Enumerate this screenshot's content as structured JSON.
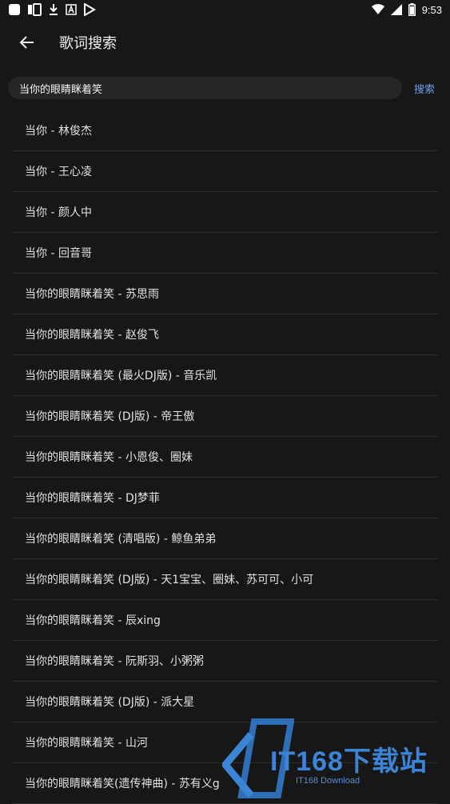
{
  "status_bar": {
    "time": "9:53",
    "left_icons": [
      "app-square-icon",
      "baozi-app-icon",
      "download-icon",
      "a-box-icon",
      "play-store-icon"
    ],
    "right_icons": [
      "wifi-icon",
      "signal-icon",
      "battery-icon"
    ]
  },
  "header": {
    "title": "歌词搜索",
    "back_icon": "arrow-left-icon"
  },
  "search": {
    "value": "当你的眼睛眯着笑",
    "button_label": "搜索"
  },
  "results": [
    "当你 - 林俊杰",
    "当你 - 王心凌",
    "当你 - 颜人中",
    "当你 - 回音哥",
    "当你的眼睛眯着笑 - 苏思雨",
    "当你的眼睛眯着笑 - 赵俊飞",
    "当你的眼睛眯着笑 (最火DJ版) - 音乐凯",
    "当你的眼睛眯着笑 (DJ版) - 帝王傲",
    "当你的眼睛眯着笑 - 小恩俊、圈妹",
    "当你的眼睛眯着笑 - DJ梦菲",
    "当你的眼睛眯着笑 (清唱版) - 鲸鱼弟弟",
    "当你的眼睛眯着笑 (DJ版) - 天1宝宝、圈妹、苏可可、小可",
    "当你的眼睛眯着笑 - 辰xing",
    "当你的眼睛眯着笑 - 阮斯羽、小粥粥",
    "当你的眼睛眯着笑 (DJ版) - 派大星",
    "当你的眼睛眯着笑 - 山河",
    "当你的眼睛眯着笑(遗传神曲) - 苏有义g"
  ],
  "watermark": {
    "text": "IT168下载站",
    "subtext": "IT168 Download"
  }
}
